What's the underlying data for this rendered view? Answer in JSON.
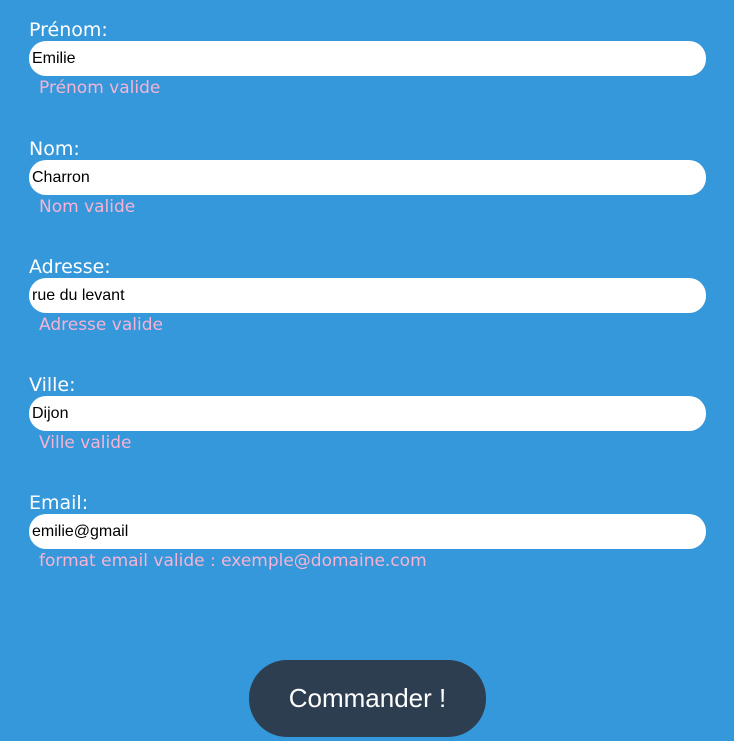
{
  "form": {
    "fields": [
      {
        "label": "Prénom:",
        "value": "Emilie",
        "message": "Prénom valide"
      },
      {
        "label": "Nom:",
        "value": "Charron",
        "message": "Nom valide"
      },
      {
        "label": "Adresse:",
        "value": "rue du levant",
        "message": "Adresse valide"
      },
      {
        "label": "Ville:",
        "value": "Dijon",
        "message": "Ville valide"
      },
      {
        "label": "Email:",
        "value": "emilie@gmail",
        "message": "format email valide : exemple@domaine.com"
      }
    ],
    "submit_label": "Commander !"
  },
  "colors": {
    "background": "#3598db",
    "label_text": "#ffffff",
    "validation_message": "#f6b3d4",
    "button_background": "#2c3e50",
    "button_text": "#ffffff"
  }
}
